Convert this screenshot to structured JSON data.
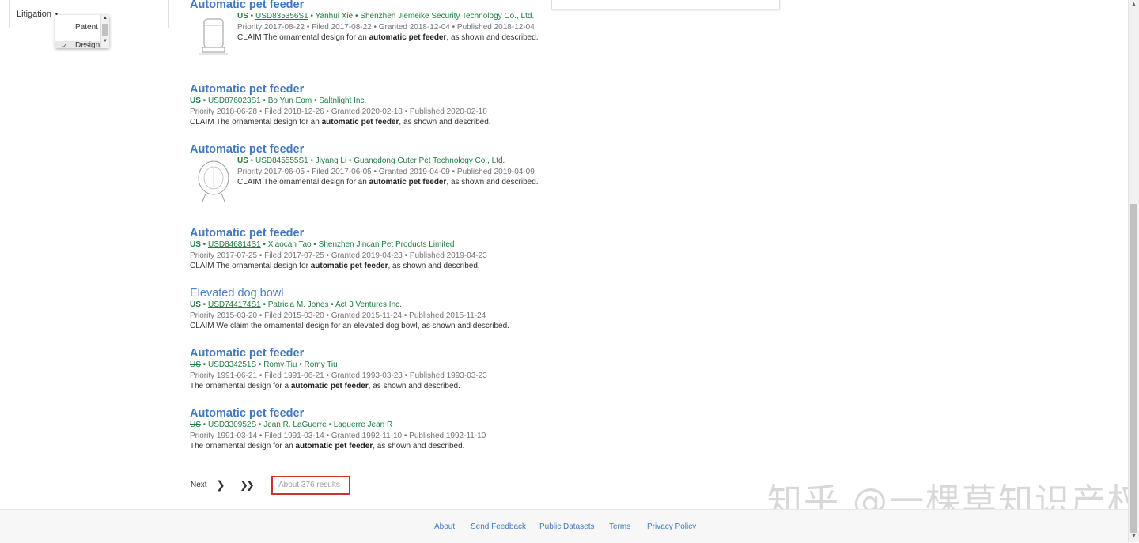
{
  "filters": {
    "litigation_label": "Litigation",
    "type_options": [
      "Patent",
      "Design"
    ],
    "selected": "Design"
  },
  "results": [
    {
      "title": "Automatic pet feeder",
      "country": "US",
      "number": "USD835356S1",
      "inventor": "Yanhui Xie",
      "assignee": "Shenzhen Jiemeike Security Technology Co., Ltd.",
      "priority": "Priority 2017-08-22",
      "filed": "Filed 2017-08-22",
      "granted": "Granted 2018-12-04",
      "published": "Published 2018-12-04",
      "claim_prefix": "CLAIM The ornamental design for an",
      "claim_suffix": ", as shown and described."
    },
    {
      "title": "Automatic pet feeder",
      "country": "US",
      "number": "USD876023S1",
      "inventor": "Bo Yun Eom",
      "assignee": "Saltnlight Inc.",
      "priority": "Priority 2018-06-28",
      "filed": "Filed 2018-12-26",
      "granted": "Granted 2020-02-18",
      "published": "Published 2020-02-18",
      "claim_prefix": "CLAIM The ornamental design for an",
      "claim_suffix": ", as shown and described."
    },
    {
      "title": "Automatic pet feeder",
      "country": "US",
      "number": "USD845555S1",
      "inventor": "Jiyang Li",
      "assignee": "Guangdong Cuter Pet Technology Co., Ltd.",
      "priority": "Priority 2017-06-05",
      "filed": "Filed 2017-06-05",
      "granted": "Granted 2019-04-09",
      "published": "Published 2019-04-09",
      "claim_prefix": "CLAIM The ornamental design for an",
      "claim_suffix": ", as shown and described."
    },
    {
      "title": "Automatic pet feeder",
      "country": "US",
      "number": "USD846814S1",
      "inventor": "Xiaocan Tao",
      "assignee": "Shenzhen Jincan Pet Products Limited",
      "priority": "Priority 2017-07-25",
      "filed": "Filed 2017-07-25",
      "granted": "Granted 2019-04-23",
      "published": "Published 2019-04-23",
      "claim_prefix": "CLAIM The ornamental design for",
      "claim_suffix": ", as shown and described."
    },
    {
      "title": "Elevated dog bowl",
      "country": "US",
      "number": "USD744174S1",
      "inventor": "Patricia M. Jones",
      "assignee": "Act 3 Ventures Inc.",
      "priority": "Priority 2015-03-20",
      "filed": "Filed 2015-03-20",
      "granted": "Granted 2015-11-24",
      "published": "Published 2015-11-24",
      "claim_text": "CLAIM We claim the ornamental design for an elevated dog bowl, as shown and described."
    },
    {
      "title": "Automatic pet feeder",
      "country": "US",
      "number": "USD334251S",
      "inventor": "Romy Tiu",
      "assignee": "Romy Tiu",
      "priority": "Priority 1991-06-21",
      "filed": "Filed 1991-06-21",
      "granted": "Granted 1993-03-23",
      "published": "Published 1993-03-23",
      "claim_prefix": "The ornamental design for a",
      "claim_suffix": ", as shown and described."
    },
    {
      "title": "Automatic pet feeder",
      "country": "US",
      "number": "USD330952S",
      "inventor": "Jean R. LaGuerre",
      "assignee": "Laguerre Jean R",
      "priority": "Priority 1991-03-14",
      "filed": "Filed 1991-03-14",
      "granted": "Granted 1992-11-10",
      "published": "Published 1992-11-10",
      "claim_prefix": "The ornamental design for an",
      "claim_suffix": ", as shown and described."
    }
  ],
  "claim_terms": [
    "automatic",
    "pet",
    "feeder"
  ],
  "separator": " • ",
  "pagination": {
    "next_label": "Next",
    "next_icon": "chevron-right-icon",
    "last_icon": "double-chevron-right-icon",
    "results_count": "About 376 results"
  },
  "watermark": "知乎 @一棵草知识产权",
  "footer": {
    "about": "About",
    "send_feedback": "Send Feedback",
    "public_datasets": "Public Datasets",
    "terms": "Terms",
    "privacy_policy": "Privacy Policy"
  },
  "colors": {
    "title_link": "#4178c0",
    "meta_green": "#1e7e3f",
    "highlight_box": "#d32f2f"
  }
}
